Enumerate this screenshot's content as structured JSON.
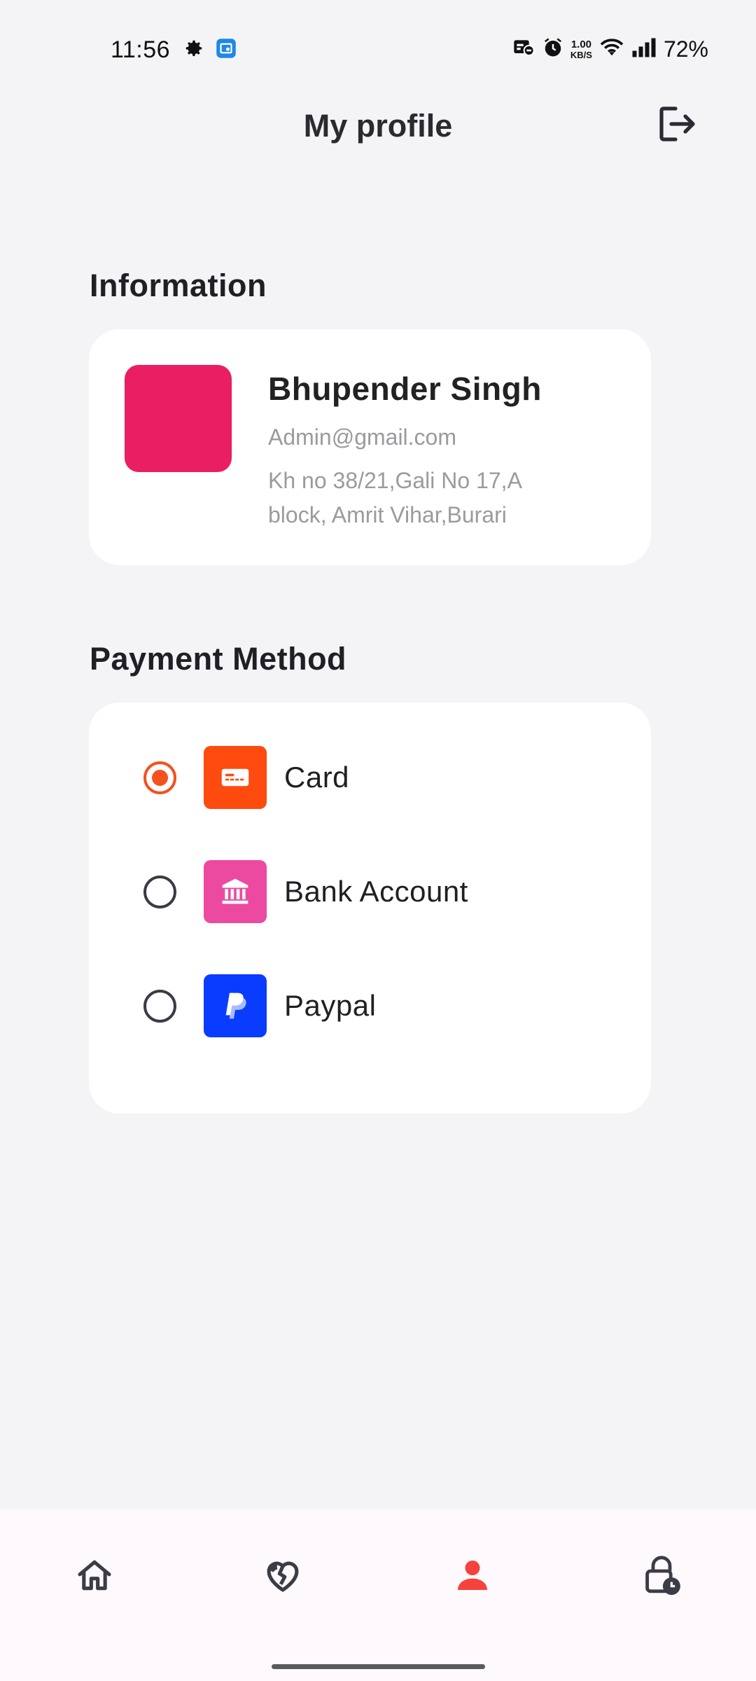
{
  "status_bar": {
    "time": "11:56",
    "net_speed_value": "1.00",
    "net_speed_unit": "KB/S",
    "battery": "72%"
  },
  "header": {
    "title": "My profile",
    "logout_icon": "logout-icon"
  },
  "information": {
    "heading": "Information",
    "name": "Bhupender Singh",
    "email": "Admin@gmail.com",
    "address": "Kh no 38/21,Gali No 17,A block, Amrit Vihar,Burari",
    "avatar_color": "#e91e63"
  },
  "payment": {
    "heading": "Payment Method",
    "methods": [
      {
        "label": "Card",
        "icon": "card-icon",
        "color": "#ff4a10",
        "selected": true
      },
      {
        "label": "Bank Account",
        "icon": "bank-icon",
        "color": "#ec4aa0",
        "selected": false
      },
      {
        "label": "Paypal",
        "icon": "paypal-icon",
        "color": "#0a3cff",
        "selected": false
      }
    ]
  },
  "bottom_nav": {
    "items": [
      {
        "icon": "home-icon",
        "active": false
      },
      {
        "icon": "broken-heart-icon",
        "active": false
      },
      {
        "icon": "person-icon",
        "active": true
      },
      {
        "icon": "lock-clock-icon",
        "active": false
      }
    ],
    "active_color": "#f4433a"
  }
}
